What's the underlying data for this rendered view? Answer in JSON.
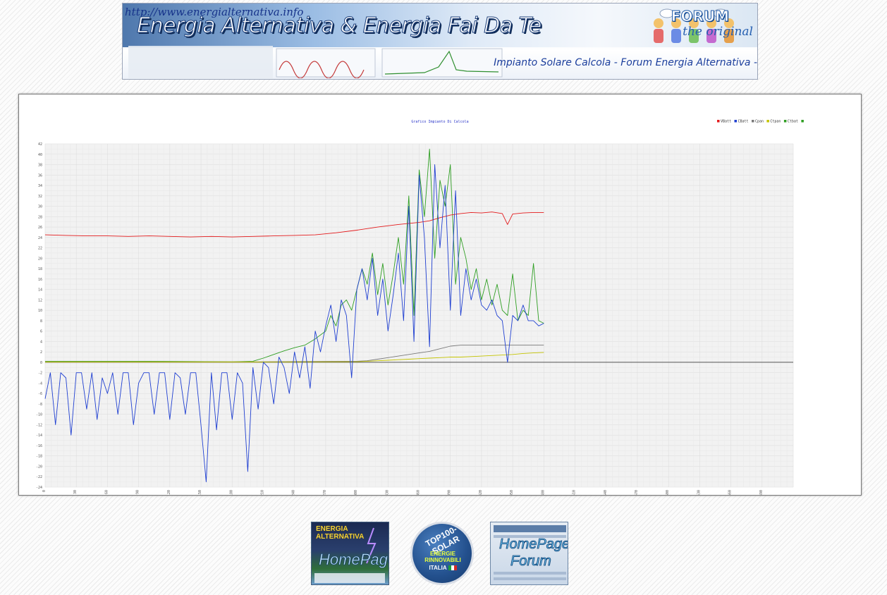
{
  "banner": {
    "url": "http://www.energialternativa.info",
    "title": "Energia Alternativa & Energia Fai Da Te",
    "forum_logo": "FORUM",
    "forum_tagline": "the original",
    "subtitle": "Impianto Solare Calcola - Forum Energia Alternativa -"
  },
  "badges": {
    "home": {
      "title_line1": "ENERGIA",
      "title_line2": "ALTERNATIVA",
      "label": "HomePage"
    },
    "top100": {
      "title": "TOP100-SOLAR",
      "sub_line1": "ENERGIE",
      "sub_line2": "RINNOVABILI",
      "country": "ITALIA"
    },
    "forum": {
      "label_line1": "HomePage",
      "label_line2": "Forum"
    }
  },
  "colors": {
    "vbatt": "#e31a1c",
    "cbatt": "#1f3fd1",
    "cpan": "#7a7a7a",
    "ctpan": "#c4c400",
    "ctbat": "#2e9e22"
  },
  "chart_data": {
    "type": "line",
    "title": "Grafico Impianto Di Calcola",
    "xlabel": "",
    "ylabel": "",
    "xlim": [
      0,
      720
    ],
    "ylim": [
      -24,
      42
    ],
    "xticks": [
      0,
      30,
      60,
      90,
      120,
      150,
      180,
      210,
      240,
      270,
      300,
      330,
      360,
      390,
      420,
      450,
      480,
      510,
      540,
      570,
      600,
      630,
      660,
      690
    ],
    "yticks": [
      -24,
      -22,
      -20,
      -18,
      -16,
      -14,
      -12,
      -10,
      -8,
      -6,
      -4,
      -2,
      0,
      2,
      4,
      6,
      8,
      10,
      12,
      14,
      16,
      18,
      20,
      22,
      24,
      26,
      28,
      30,
      32,
      34,
      36,
      38,
      40,
      42
    ],
    "grid": true,
    "legend_position": "top-right",
    "series": [
      {
        "name": "VBatt",
        "x": [
          0,
          20,
          40,
          60,
          80,
          100,
          120,
          140,
          160,
          180,
          200,
          220,
          240,
          260,
          280,
          300,
          320,
          340,
          360,
          370,
          380,
          390,
          400,
          410,
          420,
          430,
          440,
          445,
          450,
          460,
          470,
          480
        ],
        "y": [
          24.5,
          24.4,
          24.3,
          24.3,
          24.2,
          24.3,
          24.2,
          24.1,
          24.2,
          24.1,
          24.2,
          24.3,
          24.4,
          24.5,
          24.9,
          25.4,
          26.0,
          26.5,
          26.9,
          27.2,
          27.8,
          28.3,
          28.6,
          28.8,
          28.7,
          28.9,
          28.6,
          26.5,
          28.5,
          28.7,
          28.8,
          28.8
        ]
      },
      {
        "name": "CBatt",
        "x": [
          0,
          5,
          10,
          15,
          20,
          25,
          30,
          35,
          40,
          45,
          50,
          55,
          60,
          65,
          70,
          75,
          80,
          85,
          90,
          95,
          100,
          105,
          110,
          115,
          120,
          125,
          130,
          135,
          140,
          145,
          150,
          155,
          160,
          165,
          170,
          175,
          180,
          185,
          190,
          195,
          200,
          205,
          210,
          215,
          220,
          225,
          230,
          235,
          240,
          245,
          250,
          255,
          260,
          265,
          270,
          275,
          280,
          285,
          290,
          295,
          300,
          305,
          310,
          315,
          320,
          325,
          330,
          335,
          340,
          345,
          350,
          355,
          360,
          365,
          370,
          375,
          380,
          385,
          390,
          395,
          400,
          405,
          410,
          415,
          420,
          425,
          430,
          435,
          440,
          445,
          450,
          455,
          460,
          465,
          470,
          475,
          480
        ],
        "y": [
          -7,
          -2,
          -12,
          -2,
          -3,
          -14,
          -2,
          -2,
          -9,
          -2,
          -11,
          -3,
          -6,
          -2,
          -10,
          -2,
          -2,
          -12,
          -4,
          -2,
          -2,
          -10,
          -2,
          -2,
          -11,
          -2,
          -3,
          -10,
          -2,
          -2,
          -12,
          -23,
          -2,
          -13,
          -2,
          -2,
          -11,
          -2,
          -4,
          -21,
          -1,
          -9,
          0,
          -1,
          -8,
          1,
          -1,
          -6,
          2,
          -3,
          3,
          -5,
          6,
          2,
          7,
          11,
          4,
          12,
          9,
          -3,
          14,
          18,
          12,
          20,
          9,
          16,
          6,
          13,
          21,
          8,
          30,
          4,
          36,
          24,
          3,
          38,
          22,
          34,
          10,
          33,
          9,
          18,
          12,
          16,
          11,
          10,
          12,
          9,
          8,
          0,
          9,
          8,
          11,
          8,
          8,
          7,
          7.5
        ]
      },
      {
        "name": "Cpan",
        "x": [
          0,
          200,
          290,
          300,
          310,
          320,
          330,
          340,
          350,
          360,
          370,
          380,
          390,
          400,
          410,
          420,
          430,
          440,
          450,
          460,
          470,
          480
        ],
        "y": [
          0.1,
          0.1,
          0.2,
          0.2,
          0.3,
          0.6,
          0.9,
          1.2,
          1.5,
          1.8,
          2.1,
          2.6,
          3.1,
          3.3,
          3.3,
          3.3,
          3.3,
          3.3,
          3.3,
          3.3,
          3.3,
          3.3
        ]
      },
      {
        "name": "Ctpan",
        "x": [
          0,
          200,
          290,
          300,
          310,
          320,
          330,
          340,
          350,
          360,
          370,
          380,
          390,
          400,
          410,
          420,
          430,
          440,
          450,
          460,
          470,
          480
        ],
        "y": [
          0.05,
          0.05,
          0.1,
          0.1,
          0.2,
          0.3,
          0.4,
          0.5,
          0.6,
          0.7,
          0.8,
          0.9,
          1.0,
          1.0,
          1.1,
          1.2,
          1.3,
          1.4,
          1.5,
          1.7,
          1.8,
          1.9
        ]
      },
      {
        "name": "Ctbat",
        "x": [
          0,
          100,
          180,
          200,
          210,
          220,
          230,
          240,
          250,
          260,
          270,
          275,
          280,
          285,
          290,
          295,
          300,
          305,
          310,
          315,
          320,
          325,
          330,
          335,
          340,
          345,
          350,
          355,
          360,
          365,
          370,
          375,
          380,
          385,
          390,
          395,
          400,
          405,
          410,
          415,
          420,
          425,
          430,
          435,
          440,
          445,
          450,
          455,
          460,
          465,
          470,
          475,
          480
        ],
        "y": [
          0.2,
          0.2,
          0.1,
          0.2,
          0.8,
          1.5,
          2.2,
          2.8,
          3.3,
          4.5,
          6,
          9,
          7,
          11,
          12,
          10,
          14,
          18,
          15,
          21,
          13,
          19,
          11,
          17,
          24,
          15,
          32,
          9,
          37,
          28,
          41,
          20,
          35,
          30,
          38,
          15,
          24,
          20,
          14,
          18,
          12,
          16,
          11,
          15,
          10,
          9,
          17,
          8,
          10,
          9,
          19,
          8,
          7.5
        ]
      }
    ]
  }
}
